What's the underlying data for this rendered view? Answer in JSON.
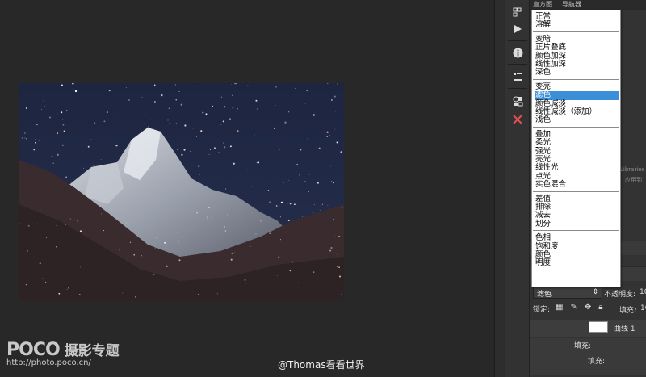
{
  "panel": {
    "tabs": [
      "直方图",
      "导航器"
    ],
    "libraries_text": "Libraries",
    "apply_text": "应用到",
    "blend_mode_current": "滤色",
    "opacity_label": "不透明度:",
    "opacity_value": "10",
    "lock_label": "锁定:",
    "fill_label": "填充:",
    "fill_value": "10",
    "layer_name": "曲线 1",
    "sub_fill_label_1": "填充:",
    "sub_fill_label_2": "填充:"
  },
  "blend_menu": {
    "groups": [
      [
        "正常",
        "溶解"
      ],
      [
        "变暗",
        "正片叠底",
        "颜色加深",
        "线性加深",
        "深色"
      ],
      [
        "变亮",
        "滤色",
        "颜色减淡",
        "线性减淡（添加）",
        "浅色"
      ],
      [
        "叠加",
        "柔光",
        "强光",
        "亮光",
        "线性光",
        "点光",
        "实色混合"
      ],
      [
        "差值",
        "排除",
        "减去",
        "划分"
      ],
      [
        "色相",
        "饱和度",
        "颜色",
        "明度"
      ]
    ],
    "selected": "滤色"
  },
  "tool_icons": [
    "history-icon",
    "play-icon",
    "info-icon",
    "properties-icon",
    "adjustments-icon",
    "tools-close-icon"
  ],
  "watermark": {
    "logo": "POCO",
    "title": "摄影专题",
    "url": "http://photo.poco.cn/"
  },
  "credit": "@Thomas看看世界",
  "colors": {
    "selection": "#3b8fd9",
    "panel_bg": "#333333",
    "workspace_bg": "#282828"
  }
}
